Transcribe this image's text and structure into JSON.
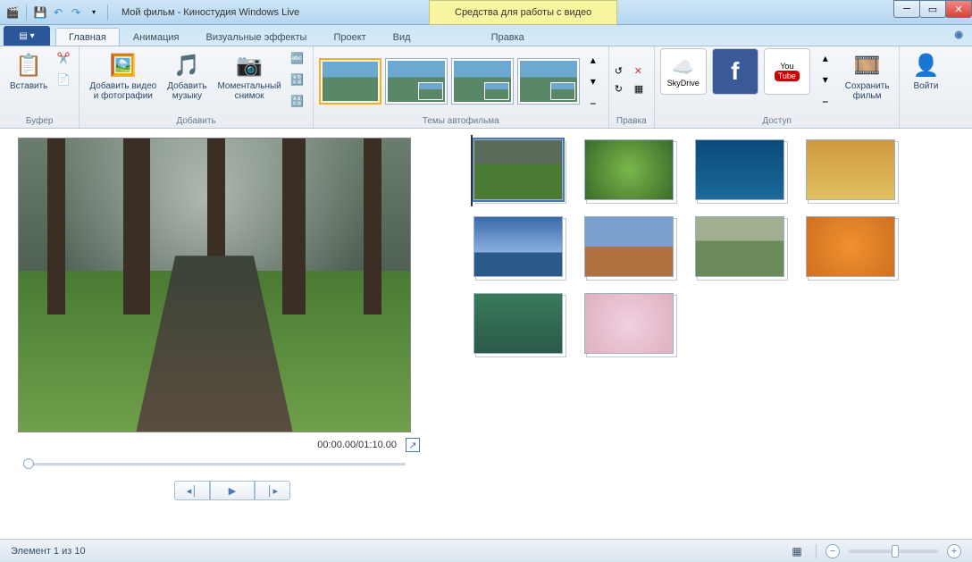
{
  "titlebar": {
    "app_title": "Мой фильм - Киностудия Windows Live",
    "context_tab": "Средства для работы с видео"
  },
  "tabs": {
    "main": "Главная",
    "animation": "Анимация",
    "effects": "Визуальные эффекты",
    "project": "Проект",
    "view": "Вид",
    "edit": "Правка"
  },
  "ribbon": {
    "paste": "Вставить",
    "buffer_group": "Буфер",
    "add_video": "Добавить видео\nи фотографии",
    "add_music": "Добавить\nмузыку",
    "snapshot": "Моментальный\nснимок",
    "add_group": "Добавить",
    "themes_group": "Темы автофильма",
    "edit_group": "Правка",
    "skydrive": "SkyDrive",
    "youtube": "YouTube",
    "share_group": "Доступ",
    "save_movie": "Сохранить\nфильм",
    "signin": "Войти"
  },
  "preview": {
    "timecode": "00:00.00/01:10.00"
  },
  "status": {
    "element_count": "Элемент 1 из 10"
  },
  "clips": [
    {
      "thumb": "bg-forest"
    },
    {
      "thumb": "bg-green"
    },
    {
      "thumb": "bg-turtle"
    },
    {
      "thumb": "bg-autumn"
    },
    {
      "thumb": "bg-sky"
    },
    {
      "thumb": "bg-desert"
    },
    {
      "thumb": "bg-meadow"
    },
    {
      "thumb": "bg-flowers"
    },
    {
      "thumb": "bg-bird"
    },
    {
      "thumb": "bg-blossom"
    }
  ]
}
